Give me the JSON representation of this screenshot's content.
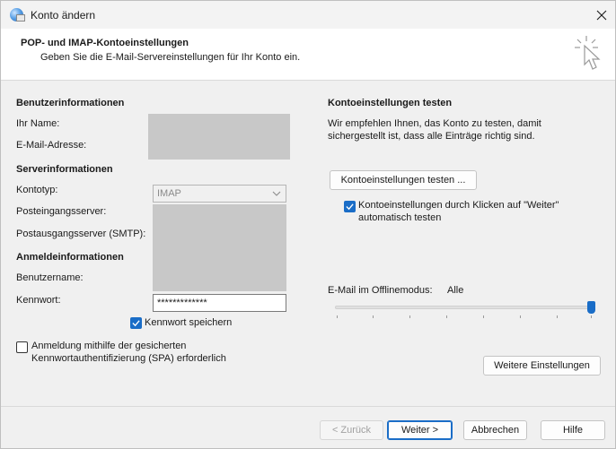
{
  "window": {
    "title": "Konto ändern"
  },
  "header": {
    "title": "POP- und IMAP-Kontoeinstellungen",
    "subtitle": "Geben Sie die E-Mail-Servereinstellungen für Ihr Konto ein."
  },
  "left": {
    "user_section": "Benutzerinformationen",
    "name_label": "Ihr Name:",
    "email_label": "E-Mail-Adresse:",
    "server_section": "Serverinformationen",
    "account_type_label": "Kontotyp:",
    "account_type_value": "IMAP",
    "incoming_label": "Posteingangsserver:",
    "outgoing_label": "Postausgangsserver (SMTP):",
    "login_section": "Anmeldeinformationen",
    "username_label": "Benutzername:",
    "password_label": "Kennwort:",
    "password_value": "*************",
    "save_password_label": "Kennwort speichern",
    "save_password_checked": true,
    "spa_label_line1": "Anmeldung mithilfe der gesicherten",
    "spa_label_line2": "Kennwortauthentifizierung (SPA) erforderlich",
    "spa_checked": false
  },
  "right": {
    "test_section": "Kontoeinstellungen testen",
    "test_desc_line1": "Wir empfehlen Ihnen, das Konto zu testen, damit",
    "test_desc_line2": "sichergestellt ist, dass alle Einträge richtig sind.",
    "test_button": "Kontoeinstellungen testen ...",
    "auto_test_line1": "Kontoeinstellungen durch Klicken auf \"Weiter\"",
    "auto_test_line2": "automatisch testen",
    "auto_test_checked": true,
    "offline_label": "E-Mail im Offlinemodus:",
    "offline_value": "Alle",
    "offline_level": 1.0,
    "more_settings_button": "Weitere Einstellungen"
  },
  "footer": {
    "back": "< Zurück",
    "next": "Weiter >",
    "cancel": "Abbrechen",
    "help": "Hilfe"
  },
  "colors": {
    "accent": "#1a6dc7",
    "redaction": "#c8c8c8"
  }
}
